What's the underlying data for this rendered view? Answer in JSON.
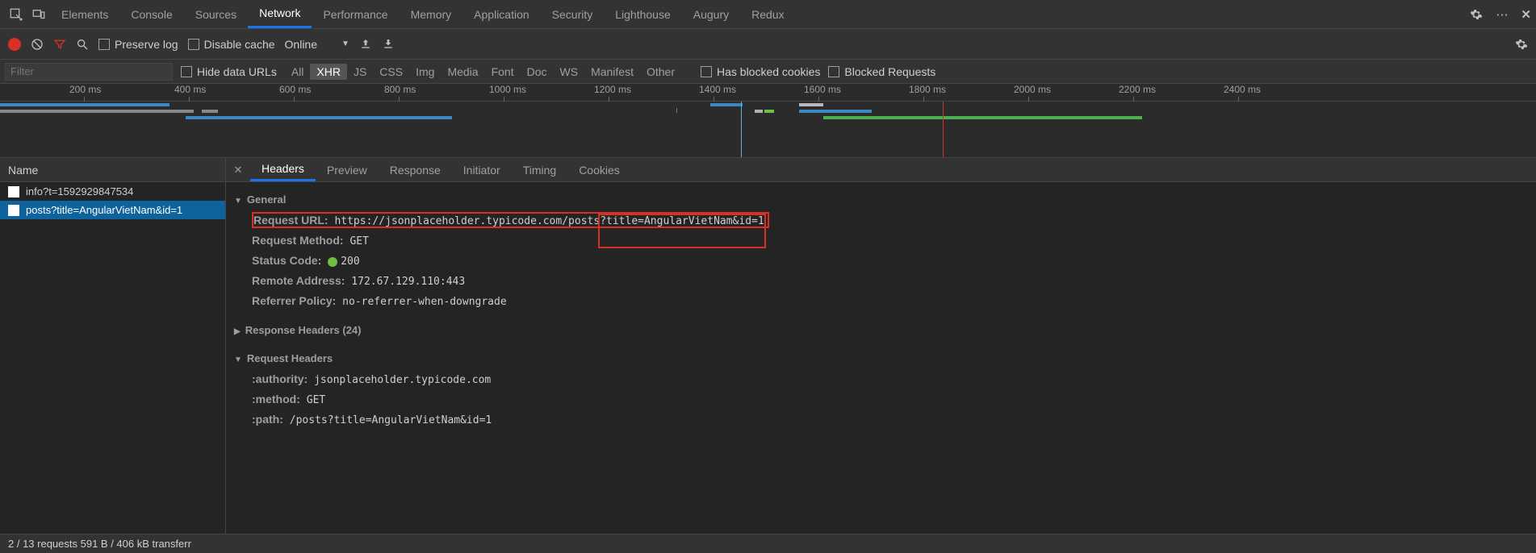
{
  "tabs": {
    "items": [
      "Elements",
      "Console",
      "Sources",
      "Network",
      "Performance",
      "Memory",
      "Application",
      "Security",
      "Lighthouse",
      "Augury",
      "Redux"
    ],
    "active": "Network"
  },
  "toolbar": {
    "preserve_log": "Preserve log",
    "disable_cache": "Disable cache",
    "online": "Online"
  },
  "filterbar": {
    "placeholder": "Filter",
    "hide_data_urls": "Hide data URLs",
    "types": [
      "All",
      "XHR",
      "JS",
      "CSS",
      "Img",
      "Media",
      "Font",
      "Doc",
      "WS",
      "Manifest",
      "Other"
    ],
    "active_type": "XHR",
    "has_blocked": "Has blocked cookies",
    "blocked_requests": "Blocked Requests"
  },
  "timeline": {
    "ticks": [
      "200 ms",
      "400 ms",
      "600 ms",
      "800 ms",
      "1000 ms",
      "1200 ms",
      "1400 ms",
      "1600 ms",
      "1800 ms",
      "2000 ms",
      "2200 ms",
      "2400 ms"
    ]
  },
  "namepanel": {
    "header": "Name",
    "rows": [
      {
        "label": "info?t=1592929847534",
        "selected": false
      },
      {
        "label": "posts?title=AngularVietNam&id=1",
        "selected": true
      }
    ]
  },
  "detail": {
    "tabs": [
      "Headers",
      "Preview",
      "Response",
      "Initiator",
      "Timing",
      "Cookies"
    ],
    "active": "Headers",
    "general": {
      "title": "General",
      "request_url_label": "Request URL:",
      "request_url_base": "https://jsonplaceholder.typicode.com/posts",
      "request_url_query": "?title=AngularVietNam&id=1",
      "request_method_label": "Request Method:",
      "request_method": "GET",
      "status_code_label": "Status Code:",
      "status_code": "200",
      "remote_address_label": "Remote Address:",
      "remote_address": "172.67.129.110:443",
      "referrer_policy_label": "Referrer Policy:",
      "referrer_policy": "no-referrer-when-downgrade"
    },
    "response_headers_title": "Response Headers (24)",
    "request_headers": {
      "title": "Request Headers",
      "authority_label": ":authority:",
      "authority": "jsonplaceholder.typicode.com",
      "method_label": ":method:",
      "method": "GET",
      "path_label": ":path:",
      "path": "/posts?title=AngularVietNam&id=1"
    }
  },
  "statusbar": {
    "text": "2 / 13 requests   591 B / 406 kB transferr"
  }
}
